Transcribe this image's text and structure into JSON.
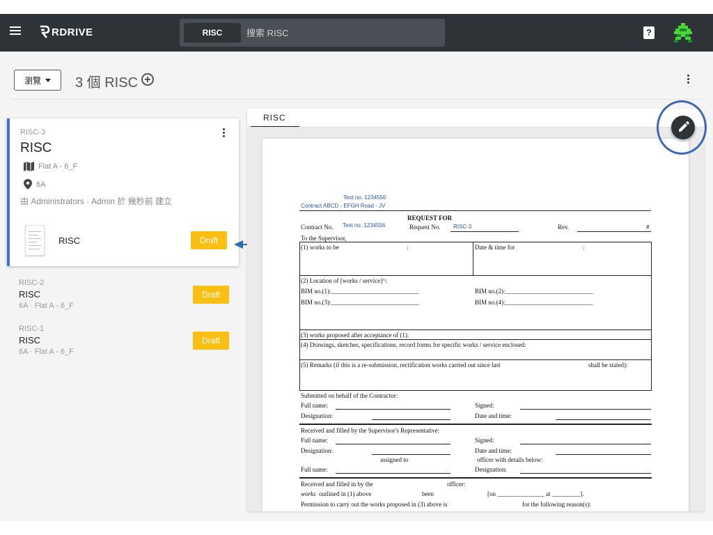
{
  "app": {
    "logo_text": "RDRIVE"
  },
  "search": {
    "scope": "RISC",
    "placeholder": "搜索 RISC"
  },
  "header": {
    "help_label": "?"
  },
  "toolbar": {
    "browse_label": "瀏覽",
    "count_title": "3 個 RISC"
  },
  "selected_card": {
    "id": "RISC-3",
    "title": "RISC",
    "location": "Flat A - 6_F",
    "sublocation": "6A",
    "creator": "由 Administrators · Admin 於 幾秒前 建立",
    "attachment_name": "RISC",
    "status": "Draft"
  },
  "list_items": [
    {
      "id": "RISC-2",
      "title": "RISC",
      "meta": "6A · Flat A - 6_F",
      "status": "Draft"
    },
    {
      "id": "RISC-1",
      "title": "RISC",
      "meta": "6A · Flat A - 6_F",
      "status": "Draft"
    }
  ],
  "document": {
    "tab": "RISC",
    "test_no_top": "Test no. 1234556",
    "contract_line": "Contract ABCD - EFGH Road - JV",
    "request_for": "REQUEST FOR",
    "contract_no_label": "Contract No.",
    "contract_no_value": "Test no. 1234556",
    "request_no_label": "Request No.",
    "request_no_value": "RISC-3",
    "rev_label": "Rev.",
    "rev_value": "#",
    "to_supervisor": "To the Supervisor,",
    "works_to_be": "(1) works to be",
    "colon": ":",
    "date_time_for": "Date & time for",
    "location_of": "(2) Location of [works / service]^:",
    "bim1": "BIM no.(1):____________________________",
    "bim2": "BIM no.(2):____________________________",
    "bim3": "BIM no.(3):____________________________",
    "bim4": "BIM no.(4):____________________________",
    "works_proposed": "(3) works proposed after acceptance of (1):",
    "drawings": "(4) Drawings, sketches, specifications, record forms for specific works / service enclosed:",
    "remarks": "(5) Remarks (if this is a re-submission, rectification works carried out since last",
    "remarks_end": "shall be stated):",
    "submitted": "Submitted on behalf of the Contractor:",
    "full_name": "Full name:",
    "signed": "Signed:",
    "designation": "Designation:",
    "date_and_time": "Date and time:",
    "received_filled": "Received and filled by the Supervisor's Representative:",
    "assigned_to": "assigned to",
    "officer_details": "officer with details below:",
    "received_filled_in": "Received and filled in by the",
    "officer": "officer:",
    "works_outlined": "works",
    "outlined_rest": "outlined in (1) above",
    "been": "been",
    "on_at": "[on _______________ at _________].",
    "permission": "Permission to carry out the works proposed in (3) above is",
    "for_reasons": "for the following reason(s):"
  },
  "colors": {
    "topbar": "#2e3338",
    "accent": "#3f72c8",
    "draft": "#f9bf13"
  }
}
